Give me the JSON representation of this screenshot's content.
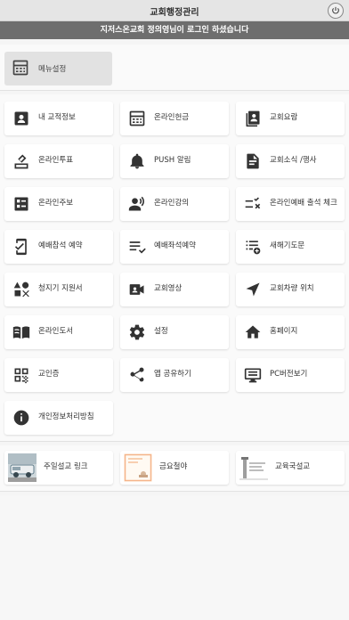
{
  "header": {
    "title": "교회행정관리"
  },
  "welcome_text": "지저스온교회 정의영님이 로그인 하셨습니다",
  "menu_settings": {
    "label": "메뉴설정",
    "icon": "calculator-icon"
  },
  "tiles": [
    {
      "label": "내 교적정보",
      "icon": "id-badge-icon"
    },
    {
      "label": "온라인헌금",
      "icon": "calculator-icon"
    },
    {
      "label": "교회요람",
      "icon": "contacts-book-icon"
    },
    {
      "label": "온라인투표",
      "icon": "ballot-icon"
    },
    {
      "label": "PUSH 알림",
      "icon": "bell-icon"
    },
    {
      "label": "교회소식 /행사",
      "icon": "document-icon"
    },
    {
      "label": "온라인주보",
      "icon": "list-card-icon"
    },
    {
      "label": "온라인강의",
      "icon": "speaker-person-icon"
    },
    {
      "label": "온라인예배 출석 체크",
      "icon": "checklist-x-icon"
    },
    {
      "label": "예배참석 예약",
      "icon": "phone-check-icon"
    },
    {
      "label": "예배좌석예약",
      "icon": "list-check-icon"
    },
    {
      "label": "새해기도문",
      "icon": "list-add-icon"
    },
    {
      "label": "청지기 지원서",
      "icon": "shapes-icon"
    },
    {
      "label": "교회영상",
      "icon": "video-camera-icon"
    },
    {
      "label": "교회차량 위치",
      "icon": "navigation-arrow-icon"
    },
    {
      "label": "온라인도서",
      "icon": "open-book-icon"
    },
    {
      "label": "설정",
      "icon": "gear-icon"
    },
    {
      "label": "홈페이지",
      "icon": "home-icon"
    },
    {
      "label": "교인증",
      "icon": "qr-code-icon"
    },
    {
      "label": "앱 공유하기",
      "icon": "share-icon"
    },
    {
      "label": "PC버전보기",
      "icon": "monitor-icon"
    },
    {
      "label": "개인정보처리방침",
      "icon": "info-icon"
    }
  ],
  "links": [
    {
      "label": "주일설교 링크",
      "thumb": "sermon-thumbnail"
    },
    {
      "label": "금요철야",
      "thumb": "friday-thumbnail"
    },
    {
      "label": "교육국설교",
      "thumb": "education-thumbnail"
    }
  ]
}
